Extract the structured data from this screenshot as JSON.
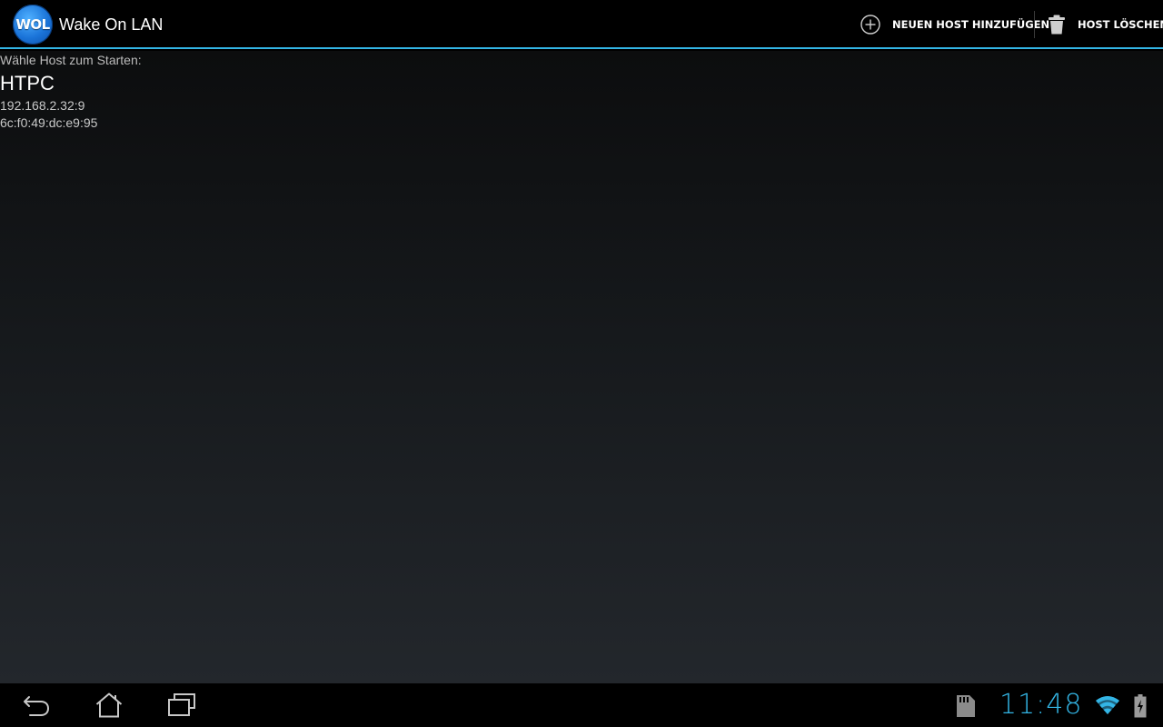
{
  "action_bar": {
    "logo_text": "WOL",
    "title": "Wake On LAN",
    "add_host_label": "NEUEN HOST HINZUFÜGEN",
    "delete_host_label": "HOST LÖSCHEN",
    "accent_color": "#33b5e5"
  },
  "content": {
    "prompt": "Wähle Host zum Starten:",
    "hosts": [
      {
        "name": "HTPC",
        "address": "192.168.2.32:9",
        "mac": "6c:f0:49:dc:e9:95"
      }
    ]
  },
  "system_bar": {
    "clock": "11:48",
    "icons": [
      "back-icon",
      "home-icon",
      "recent-apps-icon",
      "sd-card-icon",
      "wifi-icon",
      "battery-charging-icon"
    ]
  }
}
